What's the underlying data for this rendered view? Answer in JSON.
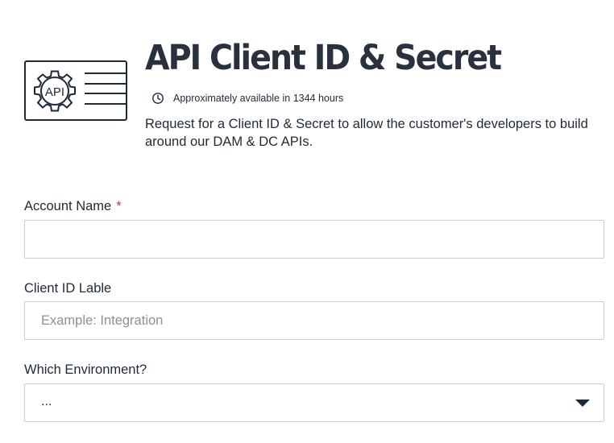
{
  "header": {
    "icon": "api-settings-icon",
    "icon_text": "API",
    "title": "API Client ID & Secret",
    "availability_icon": "clock-icon",
    "availability_text": "Approximately available in 1344 hours",
    "description": "Request for a Client ID & Secret to allow the customer's developers to build around our DAM & DC APIs."
  },
  "form": {
    "account_name": {
      "label": "Account Name",
      "required_marker": "*",
      "value": "",
      "placeholder": ""
    },
    "client_id_label": {
      "label": "Client ID Lable",
      "value": "",
      "placeholder": "Example: Integration"
    },
    "environment": {
      "label": "Which Environment?",
      "selected": "...",
      "icon": "chevron-down-icon"
    }
  },
  "colors": {
    "text": "#1f2a37",
    "required": "#d6246e",
    "border": "#c9cdd2",
    "placeholder": "#8a9099"
  }
}
